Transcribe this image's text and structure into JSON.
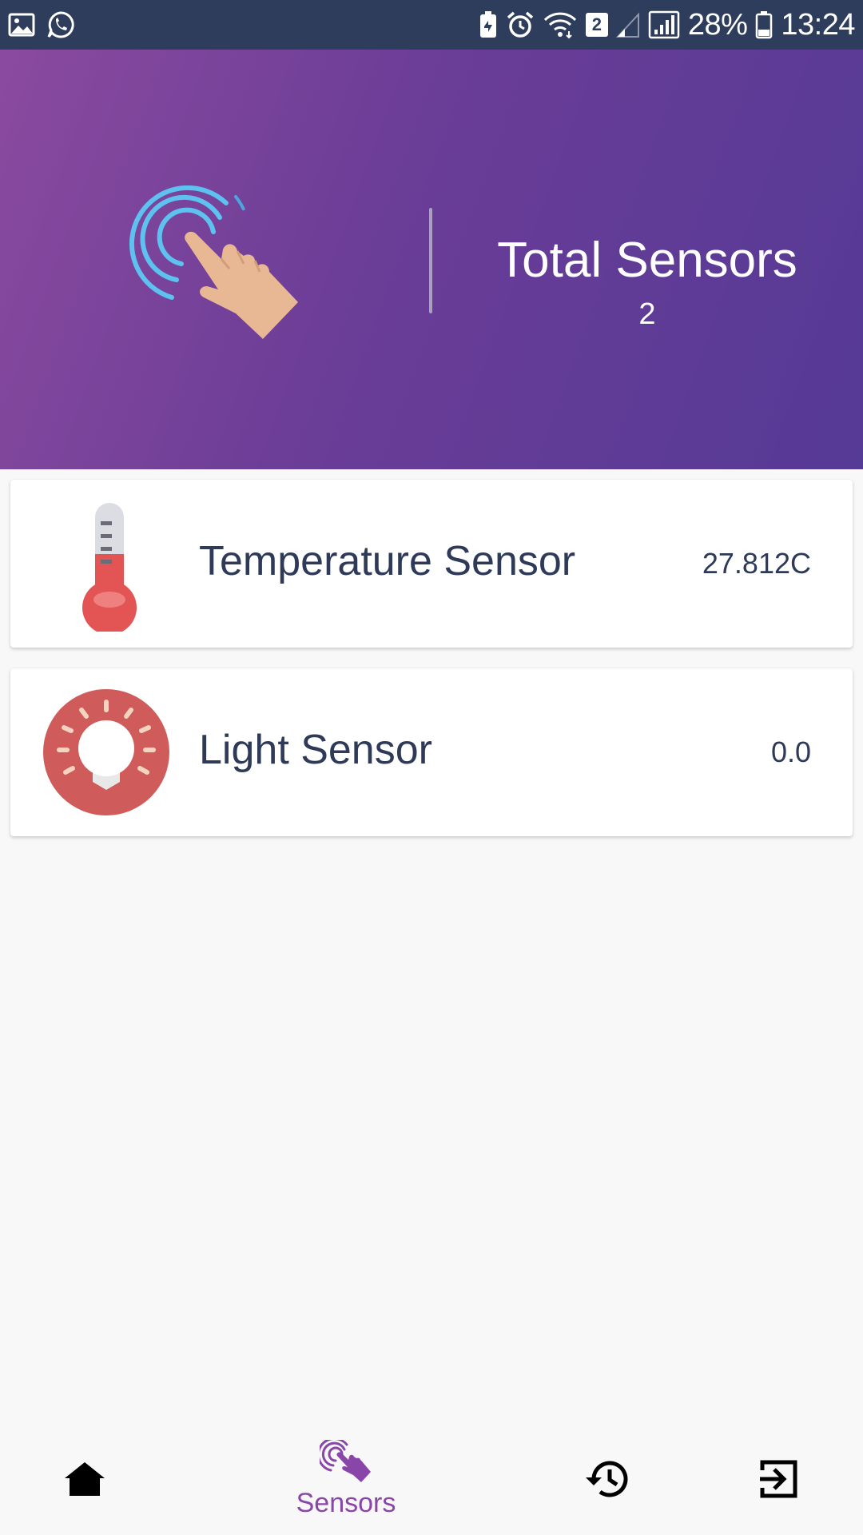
{
  "status_bar": {
    "battery_percent": "28%",
    "time": "13:24",
    "notification_badge": "2",
    "left_icons": [
      "image-icon",
      "whatsapp-icon"
    ],
    "right_icons": [
      "battery-saver-icon",
      "alarm-icon",
      "wifi-icon",
      "signal-weak-icon",
      "signal-icon",
      "battery-icon"
    ]
  },
  "header": {
    "title": "Total Sensors",
    "count": "2",
    "illustration": "touch-hand-icon",
    "gradient_start": "#8a4a9f",
    "gradient_end": "#553a96"
  },
  "sensors": [
    {
      "label": "Temperature Sensor",
      "value": "27.812C",
      "icon": "thermometer-icon"
    },
    {
      "label": "Light Sensor",
      "value": "0.0",
      "icon": "lightbulb-icon"
    }
  ],
  "bottom_nav": {
    "items": [
      {
        "icon": "home-icon",
        "label": ""
      },
      {
        "icon": "touch-hand-icon",
        "label": "Sensors",
        "active": true
      },
      {
        "icon": "history-icon",
        "label": ""
      },
      {
        "icon": "logout-icon",
        "label": ""
      }
    ],
    "active_color": "#8a45a8"
  },
  "colors": {
    "status_bar": "#2f3d5c",
    "text_primary": "#2e3a57",
    "background": "#f8f8f8"
  }
}
